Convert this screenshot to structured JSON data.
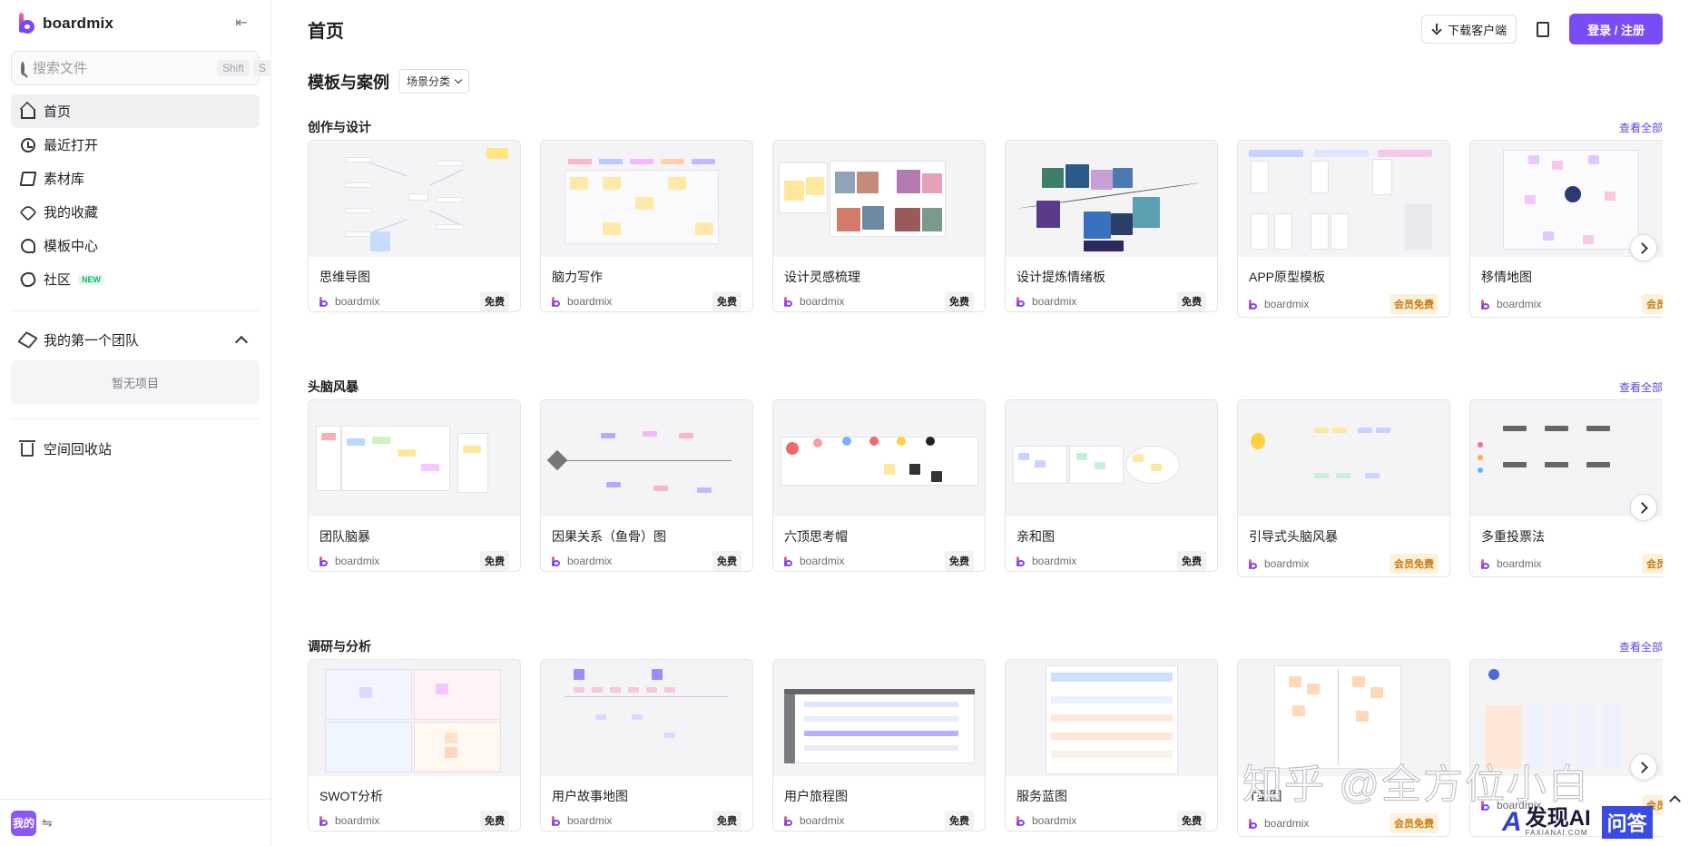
{
  "sidebar": {
    "brand": "boardmix",
    "search": {
      "placeholder": "搜索文件",
      "shortcut_1": "Shift",
      "shortcut_2": "S"
    },
    "nav": [
      {
        "label": "首页",
        "icon": "home-icon",
        "active": true
      },
      {
        "label": "最近打开",
        "icon": "clock-icon"
      },
      {
        "label": "素材库",
        "icon": "library-icon"
      },
      {
        "label": "我的收藏",
        "icon": "tag-icon"
      },
      {
        "label": "模板中心",
        "icon": "template-icon"
      },
      {
        "label": "社区",
        "icon": "community-icon",
        "badge": "NEW"
      }
    ],
    "team": {
      "label": "我的第一个团队",
      "empty": "暂无项目"
    },
    "trash": "空间回收站",
    "avatar": "我的"
  },
  "header": {
    "title": "首页",
    "download_label": "下载客户端",
    "login_label": "登录 / 注册"
  },
  "templates": {
    "title": "模板与案例",
    "scene_filter": "场景分类",
    "see_all": "查看全部",
    "categories": [
      {
        "title": "创作与设计",
        "cards": [
          {
            "title": "思维导图",
            "author": "boardmix",
            "badge": "免费"
          },
          {
            "title": "脑力写作",
            "author": "boardmix",
            "badge": "免费"
          },
          {
            "title": "设计灵感梳理",
            "author": "boardmix",
            "badge": "免费"
          },
          {
            "title": "设计提炼情绪板",
            "author": "boardmix",
            "badge": "免费"
          },
          {
            "title": "APP原型模板",
            "author": "boardmix",
            "badge": "会员免费"
          },
          {
            "title": "移情地图",
            "author": "boardmix",
            "badge": "会员"
          }
        ]
      },
      {
        "title": "头脑风暴",
        "cards": [
          {
            "title": "团队脑暴",
            "author": "boardmix",
            "badge": "免费"
          },
          {
            "title": "因果关系（鱼骨）图",
            "author": "boardmix",
            "badge": "免费"
          },
          {
            "title": "六顶思考帽",
            "author": "boardmix",
            "badge": "免费"
          },
          {
            "title": "亲和图",
            "author": "boardmix",
            "badge": "免费"
          },
          {
            "title": "引导式头脑风暴",
            "author": "boardmix",
            "badge": "会员免费"
          },
          {
            "title": "多重投票法",
            "author": "boardmix",
            "badge": "会员"
          }
        ]
      },
      {
        "title": "调研与分析",
        "cards": [
          {
            "title": "SWOT分析",
            "author": "boardmix",
            "badge": "免费"
          },
          {
            "title": "用户故事地图",
            "author": "boardmix",
            "badge": "免费"
          },
          {
            "title": "用户旅程图",
            "author": "boardmix",
            "badge": "免费"
          },
          {
            "title": "服务蓝图",
            "author": "boardmix",
            "badge": "免费"
          },
          {
            "title": "T型图",
            "author": "boardmix",
            "badge": "会员免费"
          },
          {
            "title": "",
            "author": "boardmix",
            "badge": "会员"
          }
        ]
      }
    ]
  },
  "overlay": {
    "watermark": "知乎 @全方位小白",
    "logo_main": "发现AI",
    "logo_sub": "FAXIANAI.COM",
    "logo_qa": "问答"
  }
}
